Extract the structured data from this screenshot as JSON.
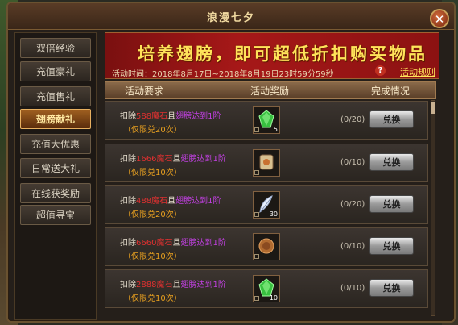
{
  "window": {
    "title": "浪漫七夕"
  },
  "sidebar": {
    "items": [
      {
        "label": "双倍经验",
        "active": false
      },
      {
        "label": "充值豪礼",
        "active": false
      },
      {
        "label": "充值售礼",
        "active": false
      },
      {
        "label": "翅膀献礼",
        "active": true
      },
      {
        "label": "充值大优惠",
        "active": false
      },
      {
        "label": "日常送大礼",
        "active": false
      },
      {
        "label": "在线获奖励",
        "active": false
      },
      {
        "label": "超值寻宝",
        "active": false
      }
    ]
  },
  "banner": {
    "title": "培养翅膀，即可超低折扣购买物品",
    "time_label": "活动时间：",
    "time_value": "2018年8月17日~2018年8月19日23时59分59秒",
    "rules_link": "活动规则"
  },
  "table": {
    "headers": [
      "活动要求",
      "活动奖励",
      "完成情况"
    ],
    "rows": [
      {
        "pre": "扣除",
        "cost": "588魔石",
        "mid": "且",
        "cond": "翅膀达到1阶",
        "limit": "（仅限兑20次）",
        "qty": "5",
        "progress": "(0/20)",
        "button": "兑换",
        "icon": "green-gem-icon",
        "icon_color": "#38c040"
      },
      {
        "pre": "扣除",
        "cost": "1666魔石",
        "mid": "且",
        "cond": "翅膀达到1阶",
        "limit": "（仅限兑10次）",
        "qty": "",
        "progress": "(0/10)",
        "button": "兑换",
        "icon": "scroll-icon",
        "icon_color": "#d8c090"
      },
      {
        "pre": "扣除",
        "cost": "488魔石",
        "mid": "且",
        "cond": "翅膀达到1阶",
        "limit": "（仅限兑20次）",
        "qty": "30",
        "progress": "(0/20)",
        "button": "兑换",
        "icon": "feather-icon",
        "icon_color": "#e8f0ff"
      },
      {
        "pre": "扣除",
        "cost": "6660魔石",
        "mid": "且",
        "cond": "翅膀达到1阶",
        "limit": "（仅限兑10次）",
        "qty": "",
        "progress": "(0/10)",
        "button": "兑换",
        "icon": "bronze-coin-icon",
        "icon_color": "#b06a30"
      },
      {
        "pre": "扣除",
        "cost": "2888魔石",
        "mid": "且",
        "cond": "翅膀达到1阶",
        "limit": "（仅限兑10次）",
        "qty": "10",
        "progress": "(0/10)",
        "button": "兑换",
        "icon": "green-gem-icon",
        "icon_color": "#38c040"
      }
    ]
  }
}
